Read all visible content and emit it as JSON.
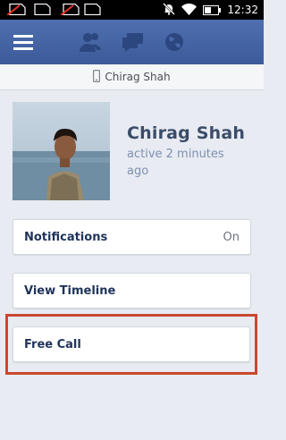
{
  "status_bar": {
    "time": "12:32",
    "icons": [
      "no-sim-icon",
      "no-sim-icon",
      "mute-icon",
      "wifi-icon",
      "battery-icon"
    ]
  },
  "topbar": {
    "icons": [
      "menu-icon",
      "friends-icon",
      "messages-icon",
      "globe-icon"
    ]
  },
  "subheader": {
    "name": "Chirag Shah",
    "icon": "phone-icon"
  },
  "profile": {
    "name": "Chirag Shah",
    "status": "active 2 minutes ago"
  },
  "items": [
    {
      "label": "Notifications",
      "value": "On"
    },
    {
      "label": "View Timeline"
    },
    {
      "label": "Free Call"
    }
  ],
  "colors": {
    "topbar": "#3c5a9a",
    "highlight": "#c9482f",
    "background": "#e8ebf2"
  }
}
